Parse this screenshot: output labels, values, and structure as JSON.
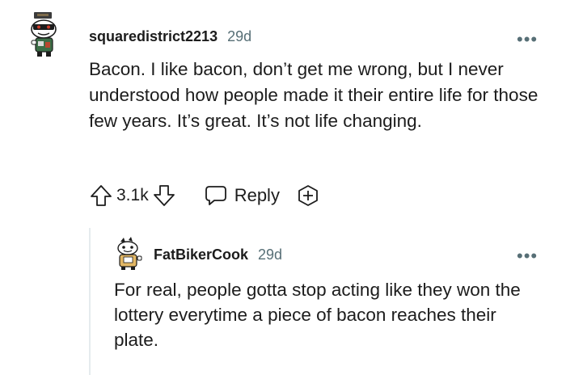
{
  "post": {
    "username": "squaredistrict2213",
    "age": "29d",
    "text": "Bacon. I like bacon, don’t get me wrong, but I never understood how people made it their entire life for those few years. It’s great. It’s not life changing.",
    "score": "3.1k",
    "reply_label": "Reply",
    "more_label": "•••",
    "icons": {
      "avatar": "snoo-avatar-icon",
      "upvote": "upvote-arrow-icon",
      "downvote": "downvote-arrow-icon",
      "reply": "speech-bubble-icon",
      "award": "award-plus-icon",
      "more": "more-options-icon"
    }
  },
  "reply": {
    "username": "FatBikerCook",
    "age": "29d",
    "text": "For real, people gotta stop acting like they won the lottery everytime a piece of bacon reaches their plate.",
    "more_label": "•••",
    "icons": {
      "avatar": "snoo-avatar-icon",
      "more": "more-options-icon"
    }
  },
  "colors": {
    "text": "#1c1c1c",
    "meta": "#576f76",
    "thread": "#e5ebee"
  }
}
